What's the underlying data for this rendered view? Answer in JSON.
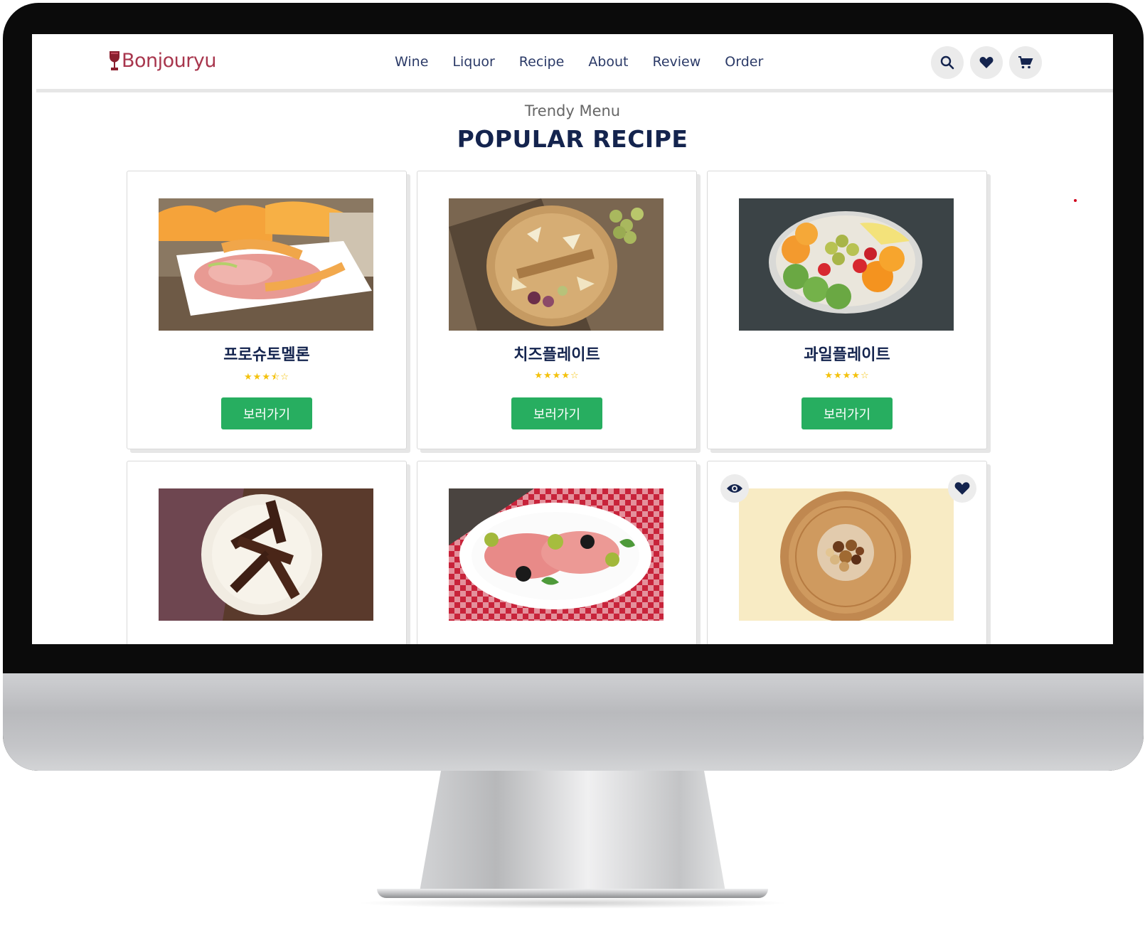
{
  "brand": {
    "name": "Bonjouryu",
    "color": "#a8364d"
  },
  "nav": {
    "links": [
      "Wine",
      "Liquor",
      "Recipe",
      "About",
      "Review",
      "Order"
    ],
    "icons": [
      "search-icon",
      "heart-icon",
      "cart-icon"
    ]
  },
  "section": {
    "subtitle": "Trendy Menu",
    "title": "POPULAR RECIPE"
  },
  "colors": {
    "accent_green": "#27ae60",
    "navy": "#14244e",
    "star": "#f4c20d"
  },
  "cards": [
    {
      "title": "프로슈토멜론",
      "rating": 3.5,
      "stars": "★★★⯪☆",
      "button": "보러가기",
      "image": "prosciutto-melon-photo"
    },
    {
      "title": "치즈플레이트",
      "rating": 4,
      "stars": "★★★★☆",
      "button": "보러가기",
      "image": "cheese-board-photo"
    },
    {
      "title": "과일플레이트",
      "rating": 4,
      "stars": "★★★★☆",
      "button": "보러가기",
      "image": "fruit-plate-photo"
    },
    {
      "image": "chocolate-nougat-photo"
    },
    {
      "image": "prosciutto-plate-photo"
    },
    {
      "image": "mixed-nuts-photo",
      "overlay_icons": [
        "eye-icon",
        "heart-icon"
      ]
    }
  ]
}
